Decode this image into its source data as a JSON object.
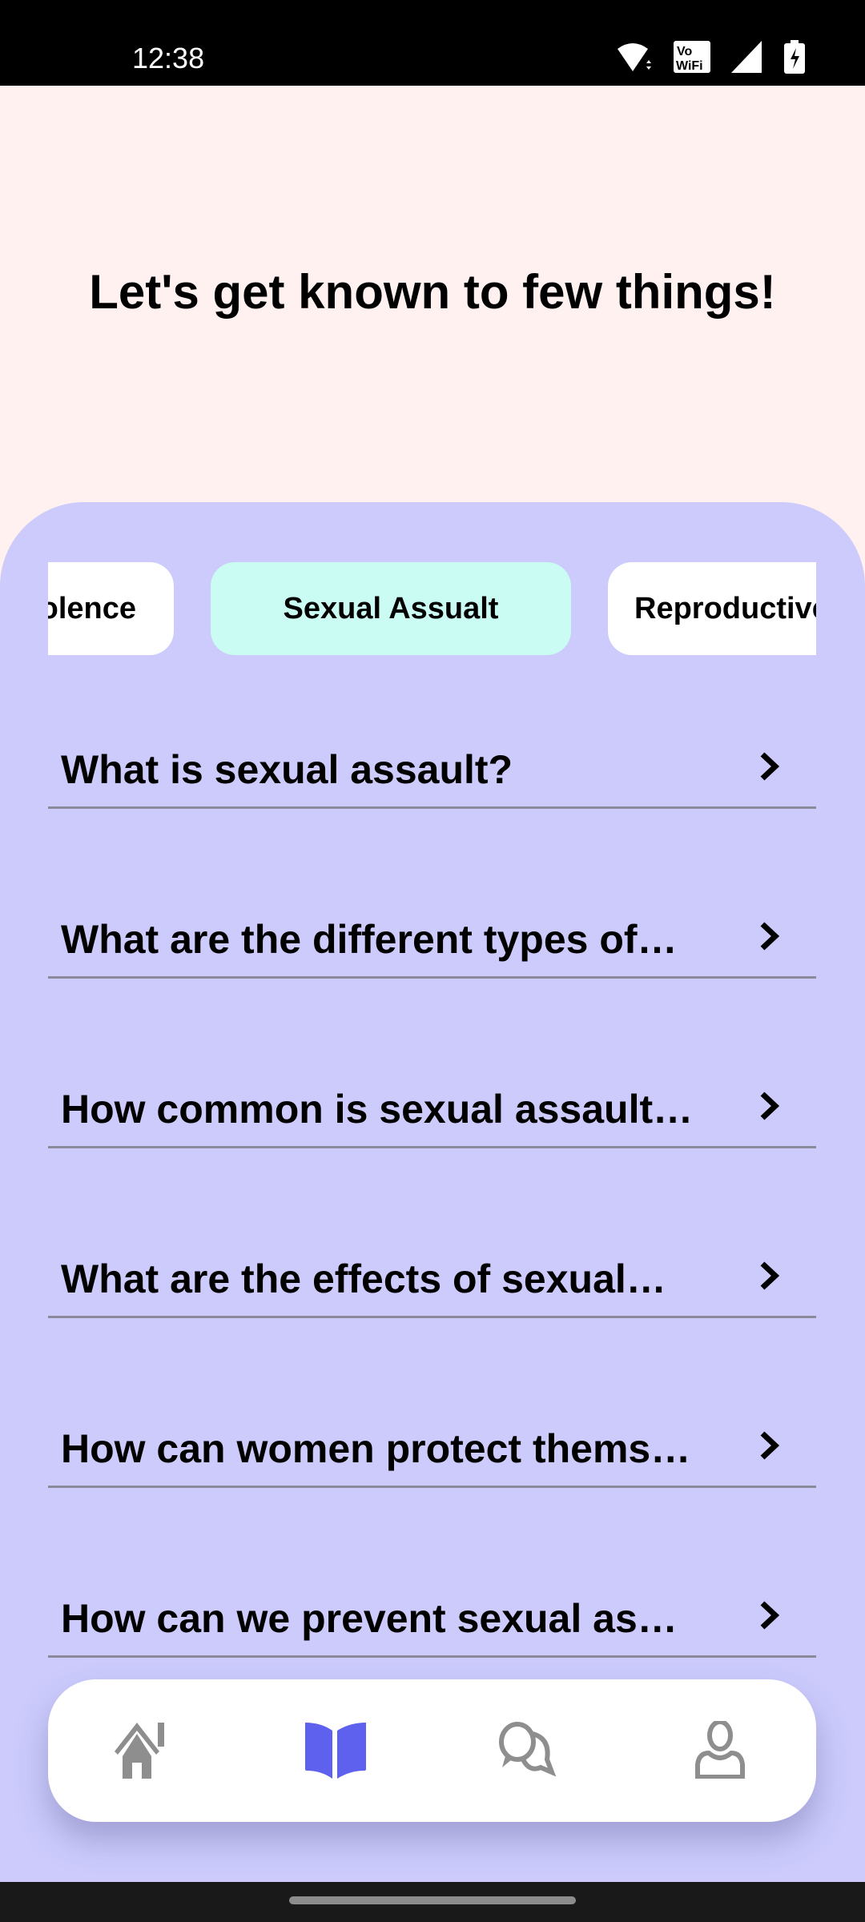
{
  "status_bar": {
    "time": "12:38",
    "icons": [
      "wifi-icon",
      "vowifi-icon",
      "signal-icon",
      "battery-charging-icon"
    ]
  },
  "header": {
    "title": "Let's get known to few things!"
  },
  "categories": [
    {
      "label": "Domestic Violence",
      "visible": "olence"
    },
    {
      "label": "Sexual Assualt",
      "active": true
    },
    {
      "label": "Reproductive"
    }
  ],
  "questions": [
    "What is sexual assault?",
    "What are the different types of…",
    "How common is sexual assault…",
    "What are the effects of sexual…",
    "How can women protect thems…",
    "How can we prevent sexual as…"
  ],
  "nav": {
    "items": [
      {
        "icon": "home-icon"
      },
      {
        "icon": "book-icon",
        "active": true
      },
      {
        "icon": "chat-icon"
      },
      {
        "icon": "profile-icon"
      }
    ],
    "active_color": "#5d61ed",
    "inactive_color": "#8e8e8e"
  },
  "colors": {
    "top_bg": "#fef1f0",
    "panel_bg": "#cccbfc",
    "active_chip": "#cbfcf4"
  }
}
